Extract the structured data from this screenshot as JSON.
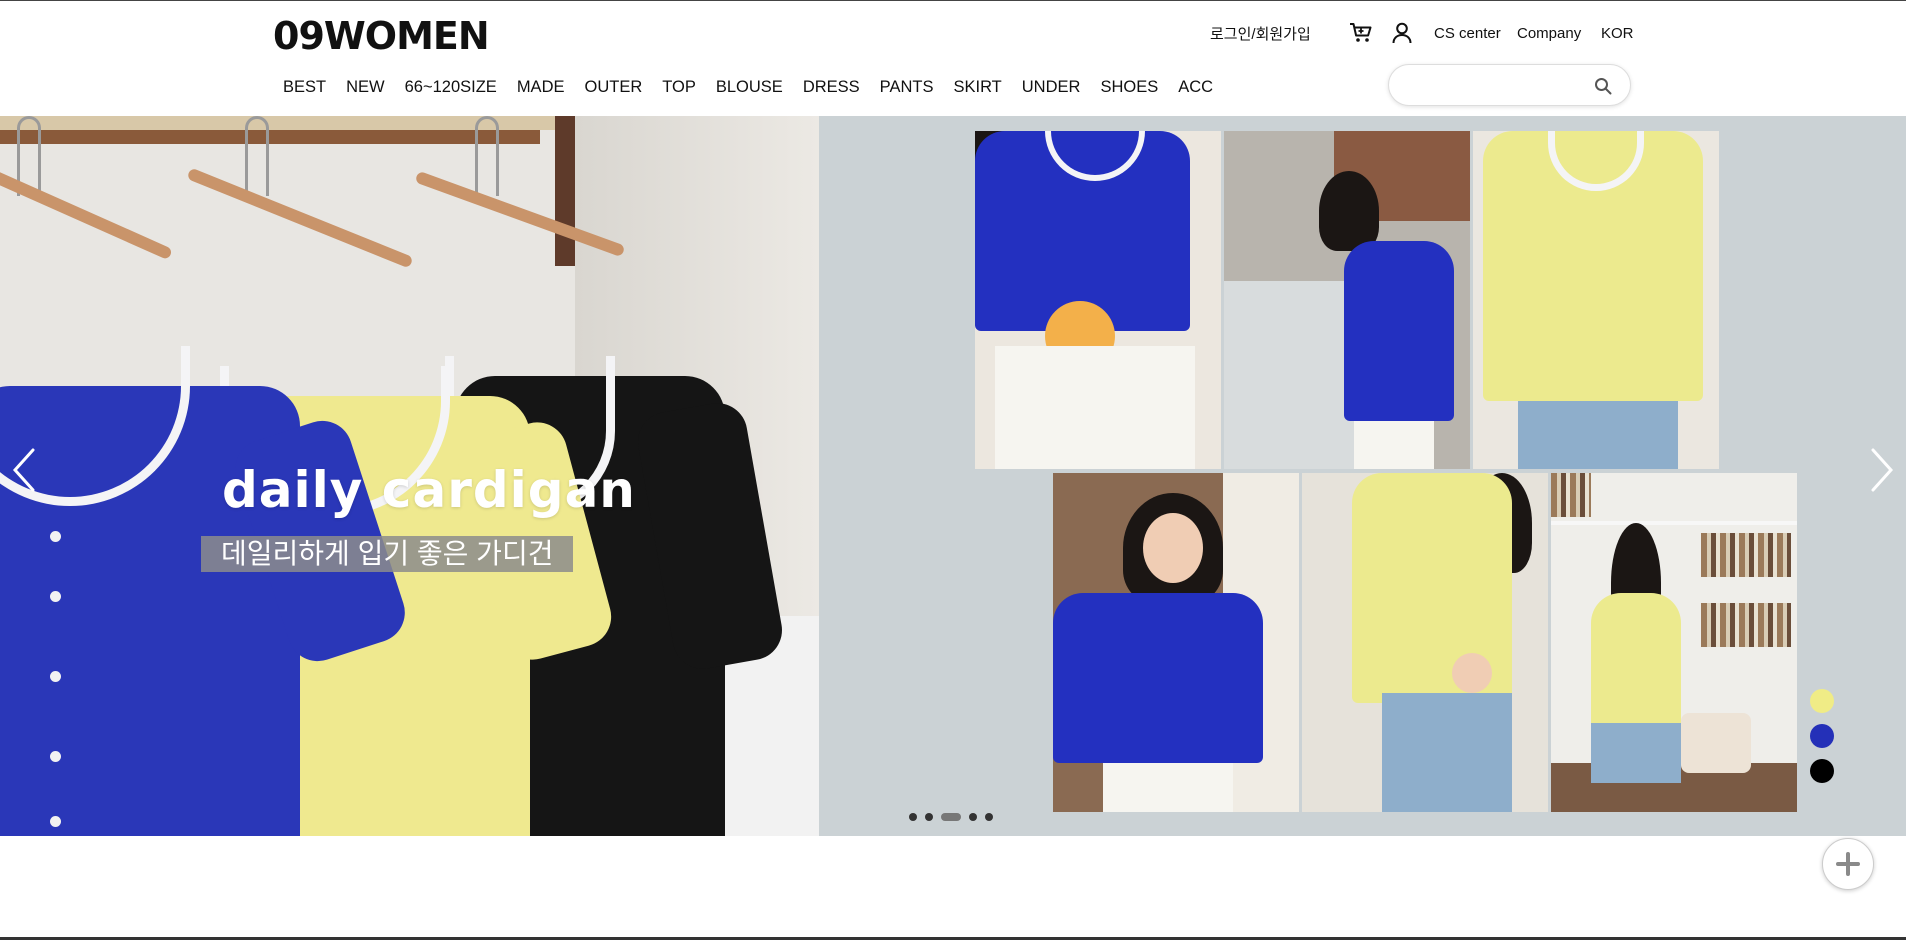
{
  "brand": {
    "logo_text": "09WOMEN"
  },
  "utility": {
    "login_label": "로그인/회원가입",
    "cart_icon": "cart-icon",
    "user_icon": "user-icon",
    "cs_label": "CS center",
    "company_label": "Company",
    "lang_label": "KOR"
  },
  "nav": {
    "items": [
      {
        "label": "BEST"
      },
      {
        "label": "NEW"
      },
      {
        "label": "66~120SIZE"
      },
      {
        "label": "MADE"
      },
      {
        "label": "OUTER"
      },
      {
        "label": "TOP"
      },
      {
        "label": "BLOUSE"
      },
      {
        "label": "DRESS"
      },
      {
        "label": "PANTS"
      },
      {
        "label": "SKIRT"
      },
      {
        "label": "UNDER"
      },
      {
        "label": "SHOES"
      },
      {
        "label": "ACC"
      }
    ]
  },
  "search": {
    "placeholder": "",
    "value": "",
    "icon": "search-icon"
  },
  "banner": {
    "headline": "daily cardigan",
    "subline": "데일리하게 입기 좋은 가디건",
    "slide_count": 5,
    "active_slide": 3,
    "color_swatches": [
      "#f0ec86",
      "#2430b8",
      "#000000"
    ]
  },
  "colors": {
    "accent_blue": "#2a37b8",
    "accent_yellow": "#efe98f",
    "panel_bg": "#cbd2d5"
  },
  "floating": {
    "plus_icon": "plus-icon"
  }
}
